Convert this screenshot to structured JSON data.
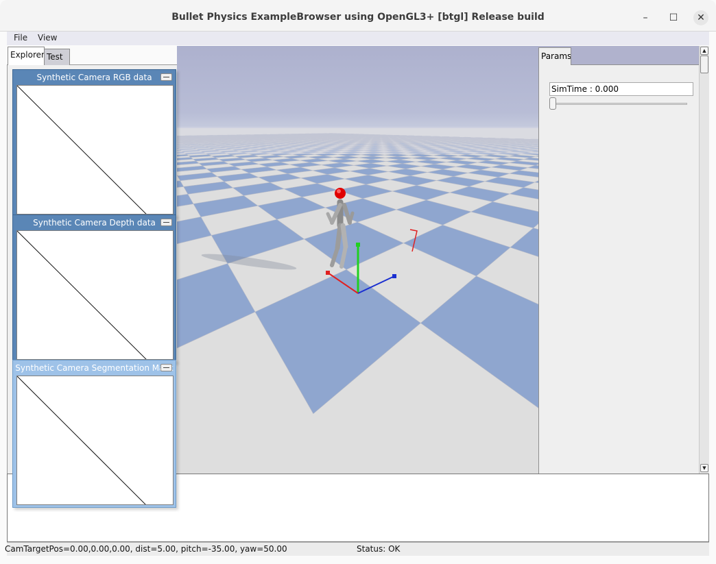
{
  "window": {
    "title": "Bullet Physics ExampleBrowser using OpenGL3+ [btgl] Release build",
    "minimize_glyph": "–",
    "maximize_glyph": "☐",
    "close_glyph": "✕"
  },
  "menu": {
    "file": "File",
    "view": "View"
  },
  "tabs": {
    "explorer": "Explorer",
    "test": "Test"
  },
  "camera_windows": [
    {
      "title": "Synthetic Camera RGB data"
    },
    {
      "title": "Synthetic Camera Depth data"
    },
    {
      "title": "Synthetic Camera Segmentation Mask"
    }
  ],
  "params": {
    "tab_label": "Params",
    "simtime_label": "SimTime : 0.000",
    "slider_value": 0.0
  },
  "scrollbar": {
    "up_glyph": "▲",
    "down_glyph": "▼"
  },
  "status": {
    "camera": "CamTargetPos=0.00,0.00,0.00, dist=5.00, pitch=-35.00, yaw=50.00",
    "state": "Status: OK"
  },
  "colors": {
    "sky": "#aeb3cf",
    "tile_blue": "#8fa6cf",
    "tile_light": "#dedede",
    "axis_x": "#e02020",
    "axis_y": "#20d020",
    "axis_z": "#1a2fd0",
    "head": "#e00000",
    "camera_window": "#5a86b6"
  }
}
